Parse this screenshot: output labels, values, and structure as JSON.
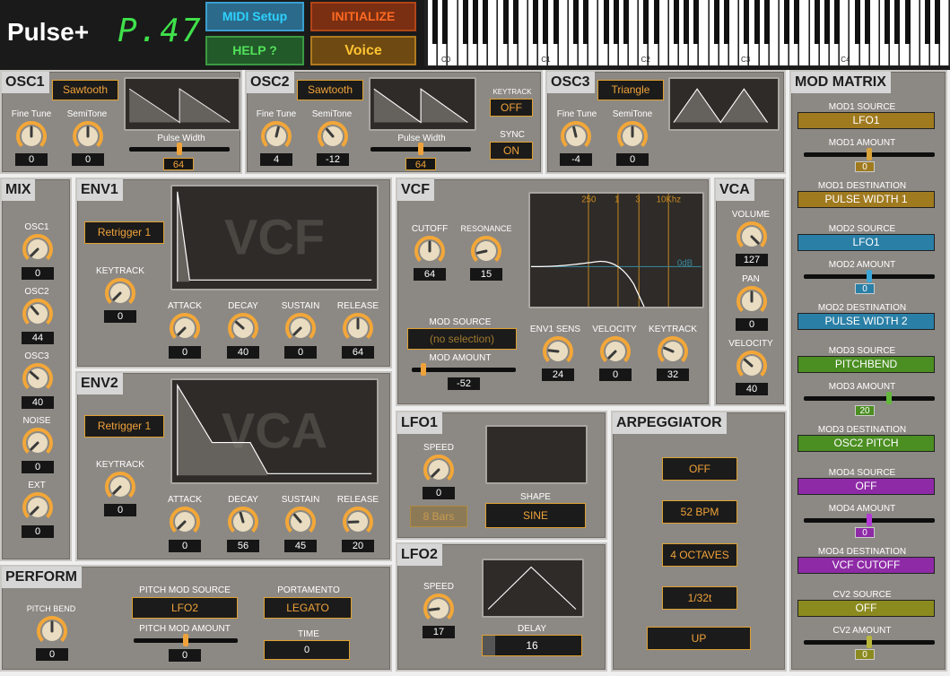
{
  "header": {
    "app_title": "Pulse+",
    "program": "P.47",
    "buttons": {
      "midi_setup": "MIDI Setup",
      "initialize": "INITIALIZE",
      "help": "HELP ?",
      "voice": "Voice"
    },
    "keyboard_labels": [
      "C0",
      "C1",
      "C2",
      "C3",
      "C4"
    ]
  },
  "osc1": {
    "title": "OSC1",
    "wave": "Sawtooth",
    "fine_tune_label": "Fine Tune",
    "fine_tune": "0",
    "semitone_label": "SemiTone",
    "semitone": "0",
    "pw_label": "Pulse Width",
    "pw": "64"
  },
  "osc2": {
    "title": "OSC2",
    "wave": "Sawtooth",
    "fine_tune_label": "Fine Tune",
    "fine_tune": "4",
    "semitone_label": "SemiTone",
    "semitone": "-12",
    "pw_label": "Pulse Width",
    "pw": "64",
    "keytrack_label": "KEYTRACK",
    "keytrack": "OFF",
    "sync_label": "SYNC",
    "sync": "ON"
  },
  "osc3": {
    "title": "OSC3",
    "wave": "Triangle",
    "fine_tune_label": "Fine Tune",
    "fine_tune": "-4",
    "semitone_label": "SemiTone",
    "semitone": "0"
  },
  "mix": {
    "title": "MIX",
    "osc1_label": "OSC1",
    "osc1": "0",
    "osc2_label": "OSC2",
    "osc2": "44",
    "osc3_label": "OSC3",
    "osc3": "40",
    "noise_label": "NOISE",
    "noise": "0",
    "ext_label": "EXT",
    "ext": "0"
  },
  "env1": {
    "title": "ENV1",
    "retrigger": "Retrigger 1",
    "keytrack_label": "KEYTRACK",
    "keytrack": "0",
    "screen_text": "VCF",
    "attack_label": "ATTACK",
    "attack": "0",
    "decay_label": "DECAY",
    "decay": "40",
    "sustain_label": "SUSTAIN",
    "sustain": "0",
    "release_label": "RELEASE",
    "release": "64"
  },
  "env2": {
    "title": "ENV2",
    "retrigger": "Retrigger 1",
    "keytrack_label": "KEYTRACK",
    "keytrack": "0",
    "screen_text": "VCA",
    "attack_label": "ATTACK",
    "attack": "0",
    "decay_label": "DECAY",
    "decay": "56",
    "sustain_label": "SUSTAIN",
    "sustain": "45",
    "release_label": "RELEASE",
    "release": "20"
  },
  "vcf": {
    "title": "VCF",
    "cutoff_label": "CUTOFF",
    "cutoff": "64",
    "resonance_label": "RESONANCE",
    "resonance": "15",
    "freq_labels": [
      "250",
      "1",
      "3",
      "10Khz"
    ],
    "db_label": "0dB",
    "mod_source_label": "MOD SOURCE",
    "mod_source": "(no selection)",
    "mod_amount_label": "MOD AMOUNT",
    "mod_amount": "-52",
    "env1_sens_label": "ENV1 SENS",
    "env1_sens": "24",
    "velocity_label": "VELOCITY",
    "velocity": "0",
    "keytrack_label": "KEYTRACK",
    "keytrack": "32"
  },
  "vca": {
    "title": "VCA",
    "volume_label": "VOLUME",
    "volume": "127",
    "pan_label": "PAN",
    "pan": "0",
    "velocity_label": "VELOCITY",
    "velocity": "40"
  },
  "lfo1": {
    "title": "LFO1",
    "speed_label": "SPEED",
    "speed": "0",
    "sync": "8 Bars",
    "shape_label": "SHAPE",
    "shape": "SINE"
  },
  "lfo2": {
    "title": "LFO2",
    "speed_label": "SPEED",
    "speed": "17",
    "delay_label": "DELAY",
    "delay": "16"
  },
  "arp": {
    "title": "ARPEGGIATOR",
    "mode": "OFF",
    "tempo": "52 BPM",
    "octaves": "4 OCTAVES",
    "rate": "1/32t",
    "direction": "UP"
  },
  "perform": {
    "title": "PERFORM",
    "pitch_bend_label": "PITCH BEND",
    "pitch_bend": "0",
    "pitch_mod_source_label": "PITCH MOD SOURCE",
    "pitch_mod_source": "LFO2",
    "pitch_mod_amount_label": "PITCH MOD AMOUNT",
    "pitch_mod_amount": "0",
    "portamento_label": "PORTAMENTO",
    "portamento": "LEGATO",
    "time_label": "TIME",
    "time": "0"
  },
  "mod_matrix": {
    "title": "MOD MATRIX",
    "mod1_source_label": "MOD1 SOURCE",
    "mod1_source": "LFO1",
    "mod1_amount_label": "MOD1 AMOUNT",
    "mod1_amount": "0",
    "mod1_dest_label": "MOD1 DESTINATION",
    "mod1_dest": "PULSE WIDTH 1",
    "mod2_source_label": "MOD2 SOURCE",
    "mod2_source": "LFO1",
    "mod2_amount_label": "MOD2 AMOUNT",
    "mod2_amount": "0",
    "mod2_dest_label": "MOD2 DESTINATION",
    "mod2_dest": "PULSE WIDTH 2",
    "mod3_source_label": "MOD3 SOURCE",
    "mod3_source": "PITCHBEND",
    "mod3_amount_label": "MOD3 AMOUNT",
    "mod3_amount": "20",
    "mod3_dest_label": "MOD3 DESTINATION",
    "mod3_dest": "OSC2 PITCH",
    "mod4_source_label": "MOD4 SOURCE",
    "mod4_source": "OFF",
    "mod4_amount_label": "MOD4 AMOUNT",
    "mod4_amount": "0",
    "mod4_dest_label": "MOD4 DESTINATION",
    "mod4_dest": "VCF CUTOFF",
    "cv2_source_label": "CV2 SOURCE",
    "cv2_source": "OFF",
    "cv2_amount_label": "CV2 AMOUNT",
    "cv2_amount": "0",
    "colors": {
      "mod1": "#a07a1f",
      "mod2": "#2a7fa6",
      "mod3": "#4b8e22",
      "mod4": "#8e2aa6",
      "cv2": "#8b8a1f"
    }
  },
  "colors": {
    "accent": "#f0a23a",
    "panel": "#8c8984",
    "lcd_green": "#3fe04a"
  }
}
